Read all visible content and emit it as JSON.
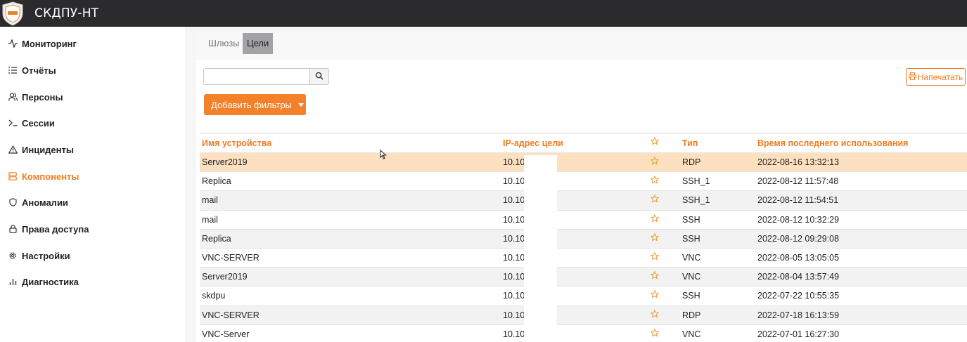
{
  "app": {
    "title": "СКДПУ-НТ"
  },
  "sidebar": {
    "items": [
      {
        "label": "Мониторинг",
        "icon": "activity-icon",
        "active": false
      },
      {
        "label": "Отчёты",
        "icon": "list-icon",
        "active": false
      },
      {
        "label": "Персоны",
        "icon": "users-icon",
        "active": false
      },
      {
        "label": "Сессии",
        "icon": "terminal-icon",
        "active": false
      },
      {
        "label": "Инциденты",
        "icon": "warning-icon",
        "active": false
      },
      {
        "label": "Компоненты",
        "icon": "server-icon",
        "active": true
      },
      {
        "label": "Аномалии",
        "icon": "shield-icon",
        "active": false
      },
      {
        "label": "Права доступа",
        "icon": "lock-icon",
        "active": false
      },
      {
        "label": "Настройки",
        "icon": "gear-icon",
        "active": false
      },
      {
        "label": "Диагностика",
        "icon": "bar-chart-icon",
        "active": false
      }
    ]
  },
  "tabs": [
    {
      "label": "Шлюзы",
      "active": false
    },
    {
      "label": "Цели",
      "active": true
    }
  ],
  "search": {
    "value": "",
    "placeholder": ""
  },
  "toolbar": {
    "filters_label": "Добавить фильтры",
    "print_label": "Напечатать"
  },
  "table": {
    "headers": {
      "name": "Имя устройства",
      "ip": "IP-адрес цели",
      "type": "Тип",
      "time": "Время последнего использования"
    },
    "rows": [
      {
        "name": "Server2019",
        "ip": "10.10",
        "type": "RDP",
        "time": "2022-08-16 13:32:13",
        "selected": true
      },
      {
        "name": "Replica",
        "ip": "10.10",
        "type": "SSH_1",
        "time": "2022-08-12 11:57:48"
      },
      {
        "name": "mail",
        "ip": "10.10",
        "type": "SSH_1",
        "time": "2022-08-12 11:54:51"
      },
      {
        "name": "mail",
        "ip": "10.10",
        "type": "SSH",
        "time": "2022-08-12 10:32:29"
      },
      {
        "name": "Replica",
        "ip": "10.10",
        "type": "SSH",
        "time": "2022-08-12 09:29:08"
      },
      {
        "name": "VNC-SERVER",
        "ip": "10.10",
        "type": "VNC",
        "time": "2022-08-05 13:05:05"
      },
      {
        "name": "Server2019",
        "ip": "10.10",
        "type": "VNC",
        "time": "2022-08-04 13:57:49"
      },
      {
        "name": "skdpu",
        "ip": "10.10",
        "type": "SSH",
        "time": "2022-07-22 10:55:35"
      },
      {
        "name": "VNC-SERVER",
        "ip": "10.10",
        "type": "RDP",
        "time": "2022-07-18 16:13:59"
      },
      {
        "name": "VNC-Server",
        "ip": "10.10",
        "type": "VNC",
        "time": "2022-07-01 16:27:30"
      }
    ]
  },
  "colors": {
    "accent": "#ef7d22",
    "topbar": "#2b2b2e",
    "selected_row": "#fde0bf",
    "button": "#f4802a"
  }
}
